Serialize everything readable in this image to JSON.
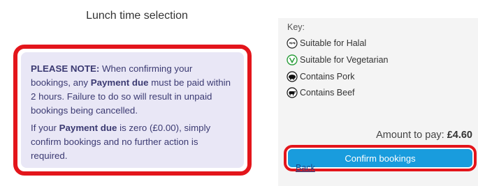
{
  "lunch": {
    "title": "Lunch time selection"
  },
  "notice": {
    "p1_strong": "PLEASE NOTE:",
    "p1_a": " When confirming your bookings, any ",
    "p1_bold": "Payment due",
    "p1_b": " must be paid within 2 hours. Failure to do so will result in unpaid bookings being cancelled.",
    "p2_a": "If your ",
    "p2_bold": "Payment due",
    "p2_b": " is zero (£0.00), simply confirm bookings and no further action is required."
  },
  "key": {
    "title": "Key:",
    "items": [
      {
        "label": "Suitable for Halal",
        "icon": "halal-icon"
      },
      {
        "label": "Suitable for Vegetarian",
        "icon": "vegetarian-icon"
      },
      {
        "label": "Contains Pork",
        "icon": "pork-icon"
      },
      {
        "label": "Contains Beef",
        "icon": "beef-icon"
      }
    ]
  },
  "payment": {
    "amount_label": "Amount to pay: ",
    "amount_value": "£4.60"
  },
  "actions": {
    "confirm_label": "Confirm bookings",
    "back_label": "Back"
  },
  "colors": {
    "highlight": "#e3151b",
    "button": "#199cdd",
    "notice_bg": "#e9e7f6",
    "notice_text": "#3b3a72",
    "vegetarian": "#2a9d3a"
  }
}
